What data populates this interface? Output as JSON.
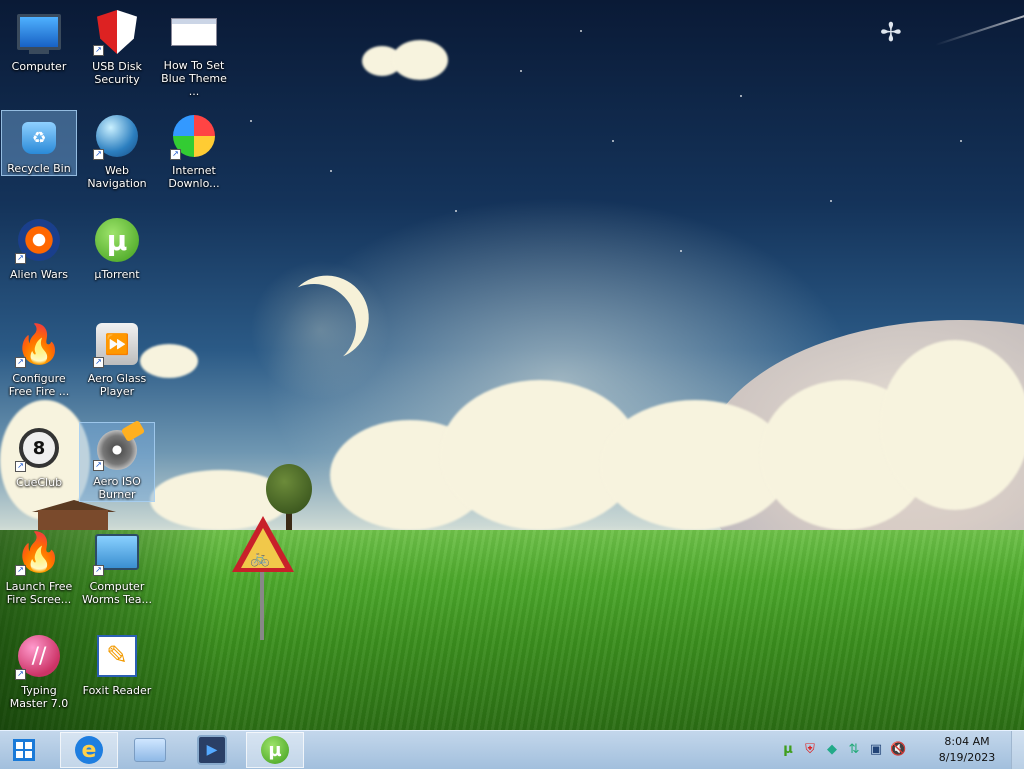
{
  "desktop": {
    "icons": [
      {
        "label": "Computer",
        "icon": "computer-icon"
      },
      {
        "label": "USB Disk Security",
        "icon": "shield-icon"
      },
      {
        "label": "How To Set Blue Theme ...",
        "icon": "document-window-icon"
      },
      {
        "label": "Recycle Bin",
        "icon": "recycle-bin-icon"
      },
      {
        "label": "Web Navigation",
        "icon": "globe-icon"
      },
      {
        "label": "Internet Downlo...",
        "icon": "download-manager-icon"
      },
      {
        "label": "Alien Wars",
        "icon": "alien-wars-icon"
      },
      {
        "label": "µTorrent",
        "icon": "utorrent-icon"
      },
      {
        "label": "Configure Free Fire ...",
        "icon": "fire-icon"
      },
      {
        "label": "Aero Glass Player",
        "icon": "media-player-icon"
      },
      {
        "label": "CueClub",
        "icon": "cueclub-icon"
      },
      {
        "label": "Aero ISO Burner",
        "icon": "disc-burner-icon"
      },
      {
        "label": "Launch Free Fire Scree...",
        "icon": "fire-icon"
      },
      {
        "label": "Computer Worms Tea...",
        "icon": "computer-worms-icon"
      },
      {
        "label": "Typing Master 7.0",
        "icon": "typing-master-icon"
      },
      {
        "label": "Foxit Reader",
        "icon": "pdf-reader-icon"
      }
    ]
  },
  "taskbar": {
    "start_icon": "windows-logo-icon",
    "pinned": [
      {
        "name": "Internet Explorer",
        "icon": "internet-explorer-icon"
      },
      {
        "name": "File Explorer",
        "icon": "folder-icon"
      },
      {
        "name": "Media Player",
        "icon": "media-player-icon"
      },
      {
        "name": "µTorrent",
        "icon": "utorrent-icon"
      }
    ],
    "tray": [
      "utorrent-icon",
      "shield-icon",
      "network-cube-icon",
      "arrows-icon",
      "network-monitor-icon",
      "volume-muted-icon"
    ],
    "clock": {
      "time": "8:04 AM",
      "date": "8/19/2023"
    }
  },
  "colors": {
    "accent": "#1a7ad8",
    "taskbar": "#b7d0ea"
  }
}
